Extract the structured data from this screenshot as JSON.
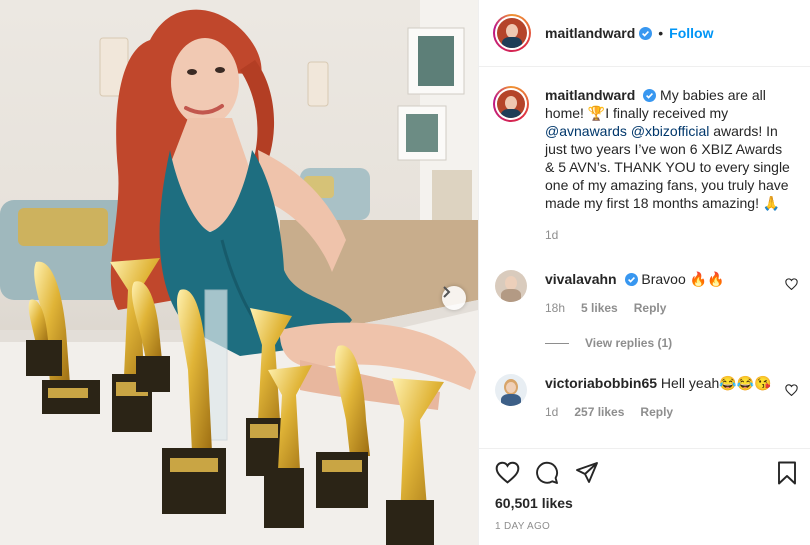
{
  "post": {
    "author": "maitlandward",
    "follow_label": "Follow",
    "separator": "•",
    "caption": "My babies are all home! 🏆I finally received my",
    "mention_1": "@avnawards",
    "mention_2": "@xbizofficial",
    "caption_end": "awards! In just two years I’ve won 6 XBIZ Awards & 5 AVN’s. THANK YOU to every single one of my amazing fans, you truly have made my first 18 months amazing! 🙏",
    "age": "1d"
  },
  "comments": [
    {
      "user": "vivalavahn",
      "text": "Bravoo 🔥🔥",
      "age": "18h",
      "likes": "5 likes",
      "reply": "Reply"
    },
    {
      "user": "victoriabobbin65",
      "text": "Hell yeah😂😂😘",
      "age": "1d",
      "likes": "257 likes",
      "reply": "Reply"
    }
  ],
  "view_replies": "View replies (1)",
  "stats": {
    "likes": "60,501 likes",
    "posted": "1 DAY AGO"
  },
  "colors": {
    "link": "#0095f6",
    "mention": "#00376b",
    "muted": "#8e8e8e",
    "dress": "#1e6e80",
    "hair": "#c0472c"
  },
  "icons": [
    "verified-badge-icon",
    "heart-icon",
    "comment-icon",
    "share-icon",
    "bookmark-icon",
    "chevron-right-icon"
  ]
}
